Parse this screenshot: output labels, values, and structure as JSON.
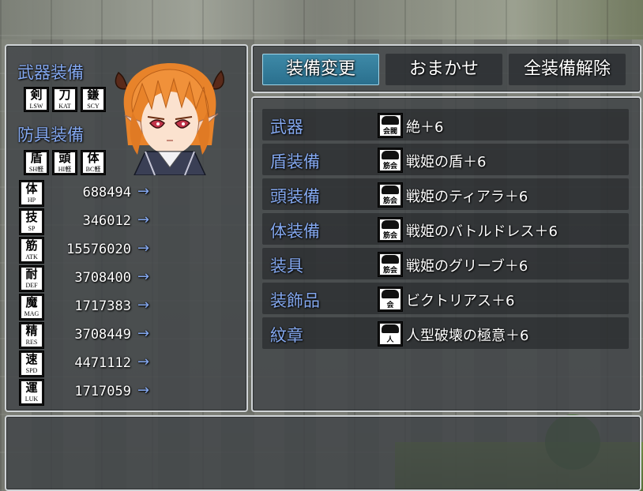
{
  "equip_panel": {
    "weapon_header": "武器装備",
    "armor_header": "防具装備",
    "weapon_skills": [
      {
        "kanji": "剣",
        "abbr": "LSW"
      },
      {
        "kanji": "刀",
        "abbr": "KAT"
      },
      {
        "kanji": "鎌",
        "abbr": "SCY"
      }
    ],
    "armor_skills": [
      {
        "kanji": "盾",
        "abbr": "SH軽"
      },
      {
        "kanji": "頭",
        "abbr": "HI軽"
      },
      {
        "kanji": "体",
        "abbr": "BC軽"
      }
    ],
    "stats": [
      {
        "kanji": "体",
        "abbr": "HP",
        "value": "688494",
        "arrow": "→"
      },
      {
        "kanji": "技",
        "abbr": "SP",
        "value": "346012",
        "arrow": "→"
      },
      {
        "kanji": "筋",
        "abbr": "ATK",
        "value": "15576020",
        "arrow": "→"
      },
      {
        "kanji": "耐",
        "abbr": "DEF",
        "value": "3708400",
        "arrow": "→"
      },
      {
        "kanji": "魔",
        "abbr": "MAG",
        "value": "1717383",
        "arrow": "→"
      },
      {
        "kanji": "精",
        "abbr": "RES",
        "value": "3708449",
        "arrow": "→"
      },
      {
        "kanji": "速",
        "abbr": "SPD",
        "value": "4471112",
        "arrow": "→"
      },
      {
        "kanji": "運",
        "abbr": "LUK",
        "value": "1717059",
        "arrow": "→"
      }
    ]
  },
  "commands": [
    {
      "label": "装備変更",
      "selected": true
    },
    {
      "label": "おまかせ",
      "selected": false
    },
    {
      "label": "全装備解除",
      "selected": false
    }
  ],
  "slots": [
    {
      "name": "武器",
      "icon": "weapon-icon",
      "icon_label": "会閥",
      "item": "絶＋6"
    },
    {
      "name": "盾装備",
      "icon": "shield-icon",
      "icon_label": "筋会",
      "item": "戦姫の盾＋6"
    },
    {
      "name": "頭装備",
      "icon": "tiara-icon",
      "icon_label": "筋会",
      "item": "戦姫のティアラ＋6"
    },
    {
      "name": "体装備",
      "icon": "dress-icon",
      "icon_label": "筋会",
      "item": "戦姫のバトルドレス＋6"
    },
    {
      "name": "装具",
      "icon": "greaves-icon",
      "icon_label": "筋会",
      "item": "戦姫のグリーブ＋6"
    },
    {
      "name": "装飾品",
      "icon": "accessory-icon",
      "icon_label": "会",
      "item": "ビクトリアス＋6"
    },
    {
      "name": "紋章",
      "icon": "crest-icon",
      "icon_label": "人",
      "item": "人型破壊の極意＋6"
    }
  ],
  "help_text": "",
  "colors": {
    "system_text": "#84a8ef",
    "normal_text": "#ffffff",
    "command_highlight": "#2f7c9c",
    "window_bg": "#3e4246"
  }
}
